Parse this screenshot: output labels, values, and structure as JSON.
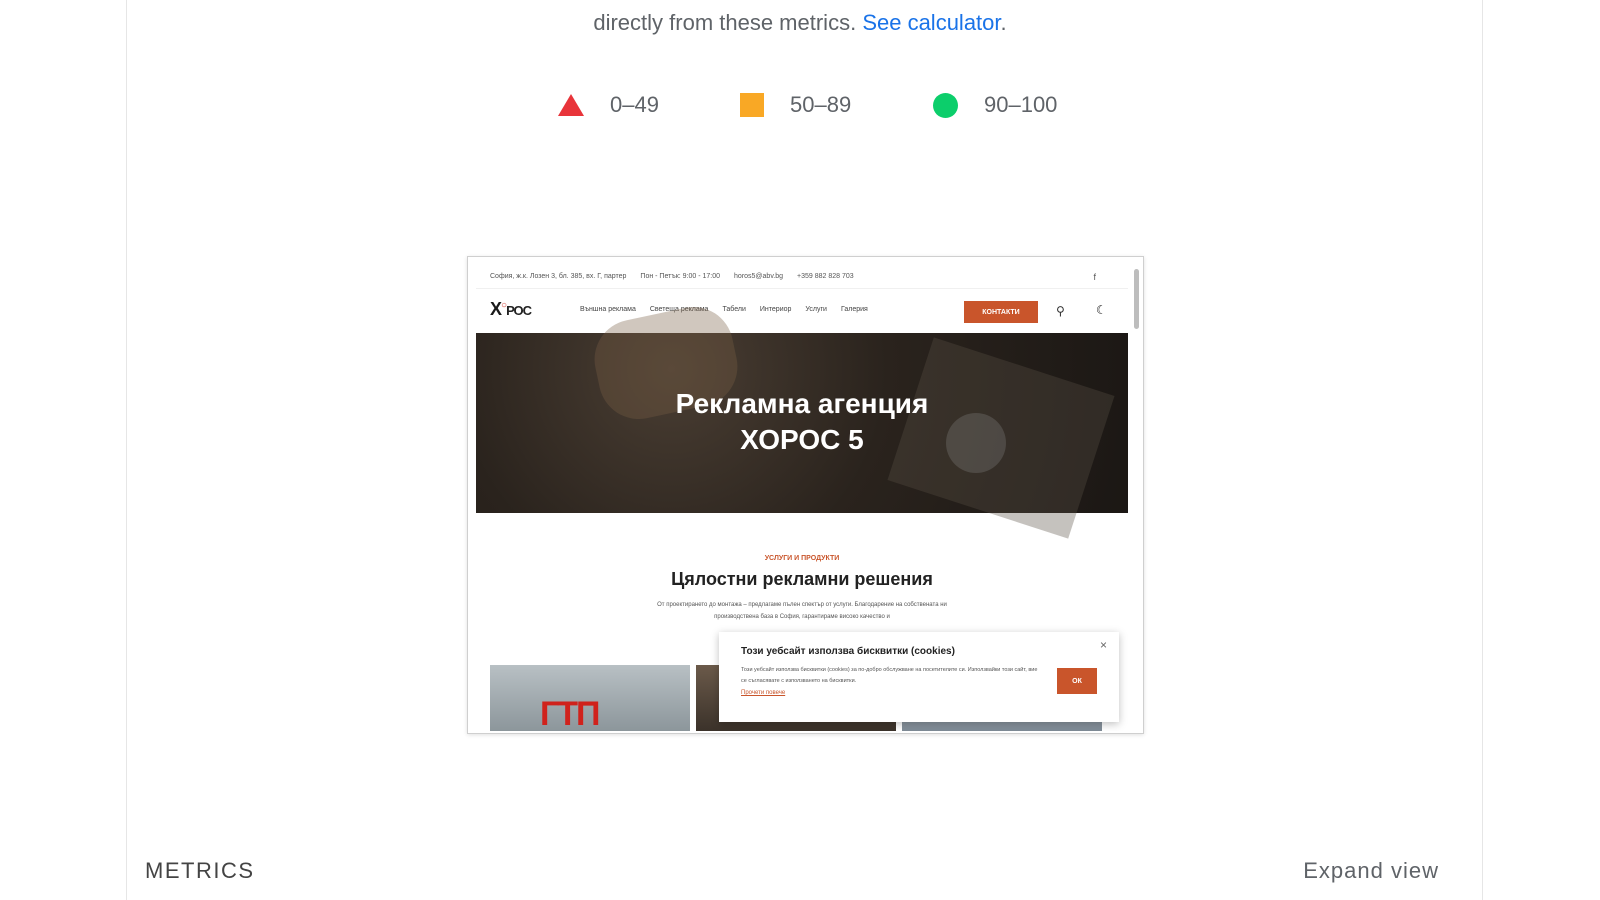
{
  "intro": {
    "text": "directly from these metrics.",
    "link": "See calculator"
  },
  "legend": [
    {
      "label": "0–49",
      "shape": "triangle",
      "color": "#e8343a"
    },
    {
      "label": "50–89",
      "shape": "square",
      "color": "#f9a825"
    },
    {
      "label": "90–100",
      "shape": "circle",
      "color": "#0cce6b"
    }
  ],
  "preview": {
    "topbar": {
      "address": "София, ж.к. Лозен 3, бл. 385, вх. Г, партер",
      "hours": "Пон - Петък: 9:00 - 17:00",
      "email": "horos5@abv.bg",
      "phone": "+359 882 828 703",
      "facebook": "f"
    },
    "logo": "ХОРОС",
    "nav": [
      "Външна реклама",
      "Светеща реклама",
      "Табели",
      "Интериор",
      "Услуги",
      "Галерия"
    ],
    "contact_button": "КОНТАКТИ",
    "hero_title_line1": "Рекламна агенция",
    "hero_title_line2": "ХОРОС 5",
    "section_kicker": "УСЛУГИ И ПРОДУКТИ",
    "section_title": "Цялостни рекламни решения",
    "section_desc": "От проектирането до монтажа – предлагаме пълен спектър от услуги. Благодарение на собствената ни производствена база в София, гарантираме високо качество и",
    "thumb_text": "ГТП",
    "cookie": {
      "title": "Този уебсайт използва бисквитки (cookies)",
      "text": "Този уебсайт използва бисквитки (cookies) за по-добро обслужване на посетителите си. Използвайки този сайт, вие се съгласявате с използването на бисквитки.",
      "link": "Прочети повече",
      "ok": "ОК",
      "close": "×"
    }
  },
  "footer": {
    "metrics_label": "METRICS",
    "expand_label": "Expand view"
  }
}
